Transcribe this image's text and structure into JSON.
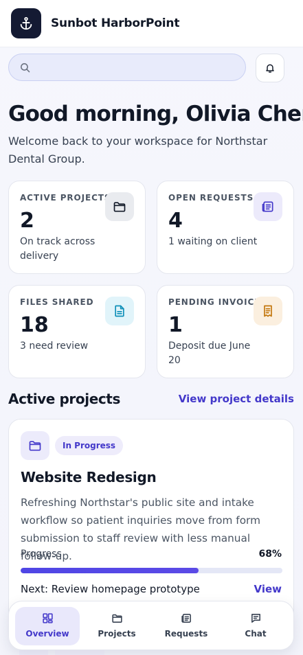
{
  "app": {
    "brand_name": "Sunbot HarborPoint",
    "logo_icon": "anchor-icon"
  },
  "search": {
    "value": "",
    "placeholder": ""
  },
  "greeting": {
    "title": "Good morning, Olivia Chen",
    "subtitle": "Welcome back to your workspace for Northstar Dental Group."
  },
  "stats": [
    {
      "label": "ACTIVE PROJECTS",
      "value": "2",
      "note": "On track across delivery",
      "icon": "folder-icon",
      "accent": "#e9ebef"
    },
    {
      "label": "OPEN REQUESTS",
      "value": "4",
      "note": "1 waiting on client",
      "icon": "request-list-icon",
      "accent": "#eceafb"
    },
    {
      "label": "FILES SHARED",
      "value": "18",
      "note": "3 need review",
      "icon": "document-icon",
      "accent": "#e1f4fa"
    },
    {
      "label": "PENDING INVOICES",
      "value": "1",
      "note": "Deposit due June 20",
      "icon": "invoice-icon",
      "accent": "#fbefdf"
    }
  ],
  "projects_section": {
    "title": "Active projects",
    "link": "View project details"
  },
  "project": {
    "status": "In Progress",
    "title": "Website Redesign",
    "description": "Refreshing Northstar's public site and intake workflow so patient inquiries move from form submission to staff review with less manual follow-up.",
    "progress_label": "Progress",
    "progress_text": "68%",
    "progress_fraction": 0.68,
    "next_step": "Next: Review homepage prototype",
    "view_link": "View"
  },
  "nav": [
    {
      "label": "Overview",
      "icon": "grid-icon",
      "active": true
    },
    {
      "label": "Projects",
      "icon": "folder-icon",
      "active": false
    },
    {
      "label": "Requests",
      "icon": "request-list-icon",
      "active": false
    },
    {
      "label": "Chat",
      "icon": "chat-icon",
      "active": false
    }
  ],
  "colors": {
    "accent": "#4338ca",
    "logo_bg": "#141a33",
    "search_bg": "#e8ebfb"
  }
}
